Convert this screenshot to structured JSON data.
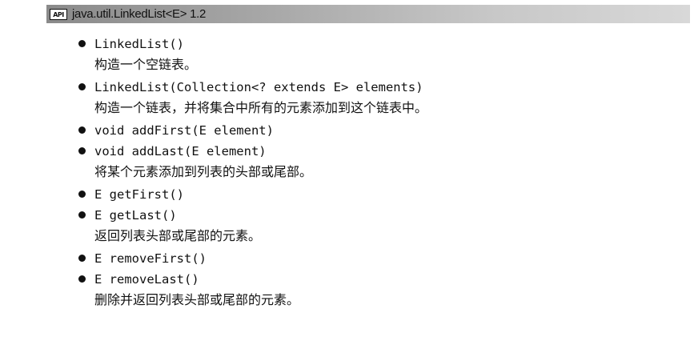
{
  "header": {
    "badge": "API",
    "title": "java.util.LinkedList<E> 1.2"
  },
  "entries": [
    {
      "method": "LinkedList()",
      "description": "构造一个空链表。"
    },
    {
      "method": "LinkedList(Collection<? extends E> elements)",
      "description": "构造一个链表，并将集合中所有的元素添加到这个链表中。"
    },
    {
      "method": "void addFirst(E element)",
      "description": ""
    },
    {
      "method": "void addLast(E element)",
      "description": "将某个元素添加到列表的头部或尾部。"
    },
    {
      "method": "E getFirst()",
      "description": ""
    },
    {
      "method": "E getLast()",
      "description": "返回列表头部或尾部的元素。"
    },
    {
      "method": "E removeFirst()",
      "description": ""
    },
    {
      "method": "E removeLast()",
      "description": "删除并返回列表头部或尾部的元素。"
    }
  ]
}
